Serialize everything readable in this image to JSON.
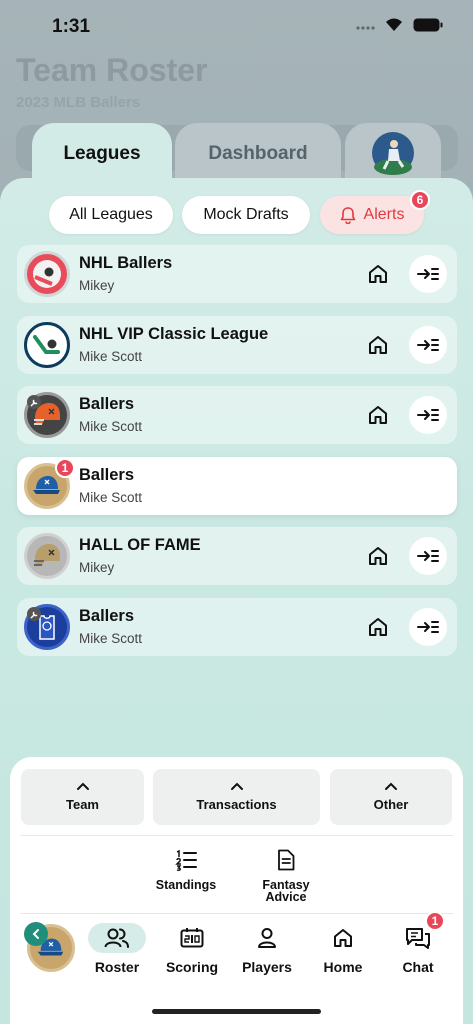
{
  "status": {
    "time": "1:31"
  },
  "background": {
    "title": "Team Roster",
    "subtitle": "2023 MLB Ballers"
  },
  "tabs": [
    {
      "label": "Leagues",
      "active": true
    },
    {
      "label": "Dashboard",
      "active": false
    }
  ],
  "filters": {
    "all": "All Leagues",
    "mock": "Mock Drafts",
    "alerts": "Alerts",
    "alerts_count": "6"
  },
  "leagues": [
    {
      "name": "NHL Ballers",
      "owner": "Mikey",
      "logo": "hockey-puck-red-logo",
      "active": false
    },
    {
      "name": "NHL VIP Classic League",
      "owner": "Mike Scott",
      "logo": "hockey-stick-logo",
      "active": false
    },
    {
      "name": "Ballers",
      "owner": "Mike Scott",
      "logo": "football-helmet-orange-logo",
      "active": false
    },
    {
      "name": "Ballers",
      "owner": "Mike Scott",
      "logo": "baseball-cap-logo",
      "active": true,
      "badge": "1"
    },
    {
      "name": "HALL OF FAME",
      "owner": "Mikey",
      "logo": "football-helmet-gold-logo",
      "active": false
    },
    {
      "name": "Ballers",
      "owner": "Mike Scott",
      "logo": "basketball-jersey-logo",
      "active": false
    }
  ],
  "menu": {
    "team": "Team",
    "transactions": "Transactions",
    "other": "Other",
    "standings": "Standings",
    "fantasy_advice": "Fantasy Advice"
  },
  "nav": {
    "roster": "Roster",
    "scoring": "Scoring",
    "players": "Players",
    "home": "Home",
    "chat": "Chat",
    "chat_count": "1"
  },
  "colors": {
    "accent": "#1f8f7c",
    "alert": "#e0393f",
    "badge": "#e8475a",
    "sheet": "#c9e8e2"
  }
}
